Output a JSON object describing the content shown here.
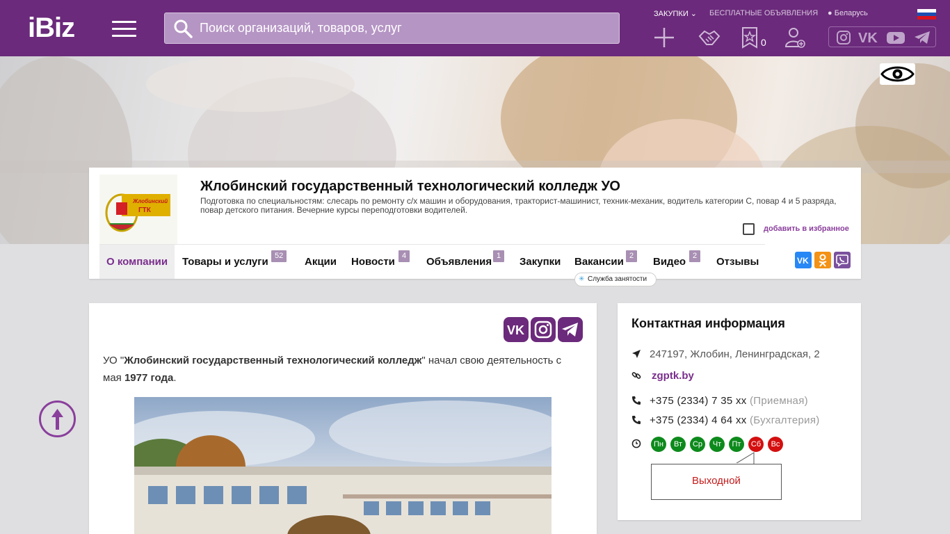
{
  "header": {
    "logo": "iBiz",
    "search_placeholder": "Поиск организаций, товаров, услуг",
    "nav_purchases": "Закупки",
    "nav_free_ads": "Бесплатные объявления",
    "region": "Беларусь",
    "favorites_count": "0",
    "icons": [
      "plus-icon",
      "handshake-icon",
      "star-bookmark-icon",
      "add-user-icon"
    ],
    "social": [
      "instagram-icon",
      "vk-icon",
      "youtube-icon",
      "telegram-icon"
    ]
  },
  "company": {
    "title": "Жлобинский государственный технологический колледж УО",
    "description": "Подготовка по специальностям: слесарь по ремонту с/х машин и оборудования, тракторист-машинист, техник-механик, водитель категории С, повар 4 и 5 разряда, повар детского питания. Вечерние курсы переподготовки водителей.",
    "logo_text": "Жлобинский ГТК",
    "add_favorite": "добавить в избранное",
    "tabs": [
      {
        "label": "О компании",
        "badge": ""
      },
      {
        "label": "Товары и услуги",
        "badge": "52"
      },
      {
        "label": "Акции",
        "badge": ""
      },
      {
        "label": "Новости",
        "badge": "4"
      },
      {
        "label": "Объявления",
        "badge": "1"
      },
      {
        "label": "Закупки",
        "badge": ""
      },
      {
        "label": "Вакансии",
        "badge": "2"
      },
      {
        "label": "Видео",
        "badge": "2"
      },
      {
        "label": "Отзывы",
        "badge": ""
      }
    ],
    "employment_service": "Служба занятости",
    "share_colors": {
      "vk": "#2787f5",
      "ok": "#f39215",
      "viber": "#7b519d"
    }
  },
  "about": {
    "intro_prefix": "УО \"",
    "intro_name": "Жлобинский государственный технологический колледж",
    "intro_mid": "\" начал свою деятельность с мая ",
    "intro_year": "1977 года",
    "intro_suffix": "."
  },
  "contact": {
    "heading": "Контактная информация",
    "address": "247197, Жлобин, Ленинградская, 2",
    "website": "zgptk.by",
    "phones": [
      {
        "number": "+375 (2334) 7 35 xx",
        "note": "(Приемная)"
      },
      {
        "number": "+375 (2334) 4 64 xx",
        "note": "(Бухгалтерия)"
      }
    ],
    "days": [
      {
        "label": "Пн",
        "status": "open"
      },
      {
        "label": "Вт",
        "status": "open"
      },
      {
        "label": "Ср",
        "status": "open"
      },
      {
        "label": "Чт",
        "status": "open"
      },
      {
        "label": "Пт",
        "status": "open"
      },
      {
        "label": "Сб",
        "status": "closed"
      },
      {
        "label": "Вс",
        "status": "closed"
      }
    ],
    "day_tooltip": "Выходной"
  },
  "colors": {
    "brand": "#6b2a7b",
    "accent": "#7a2e8c",
    "open": "#0d8a1c",
    "closed": "#d40f0f"
  }
}
